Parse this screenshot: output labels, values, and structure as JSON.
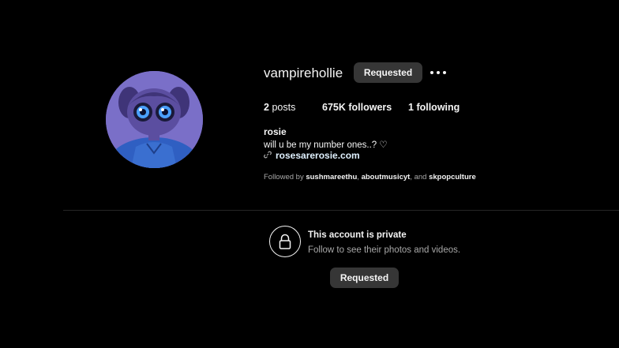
{
  "profile": {
    "username": "vampirehollie",
    "request_button_label": "Requested",
    "more_options_icon": "more-horizontal-icon",
    "stats": {
      "posts_count": "2",
      "posts_label": "posts",
      "followers_count": "675K",
      "followers_label": "followers",
      "following_count": "1",
      "following_label": "following"
    },
    "display_name": "rosie",
    "bio": "will u be my number ones..? ♡",
    "link_icon": "link-icon",
    "link_text": "rosesarerosie.com",
    "followed_by": {
      "prefix": "Followed by",
      "users": [
        "sushmareethu",
        "aboutmusicyt",
        "skpopculture"
      ],
      "sep": ",",
      "conjunction": "and"
    }
  },
  "private_notice": {
    "icon": "lock-icon",
    "title": "This account is private",
    "subtitle": "Follow to see their photos and videos.",
    "button_label": "Requested"
  },
  "colors": {
    "background": "#000000",
    "button_bg": "#363636",
    "text_primary": "#f5f5f5",
    "text_secondary": "#a8a8a8",
    "link": "#e0f1ff"
  }
}
